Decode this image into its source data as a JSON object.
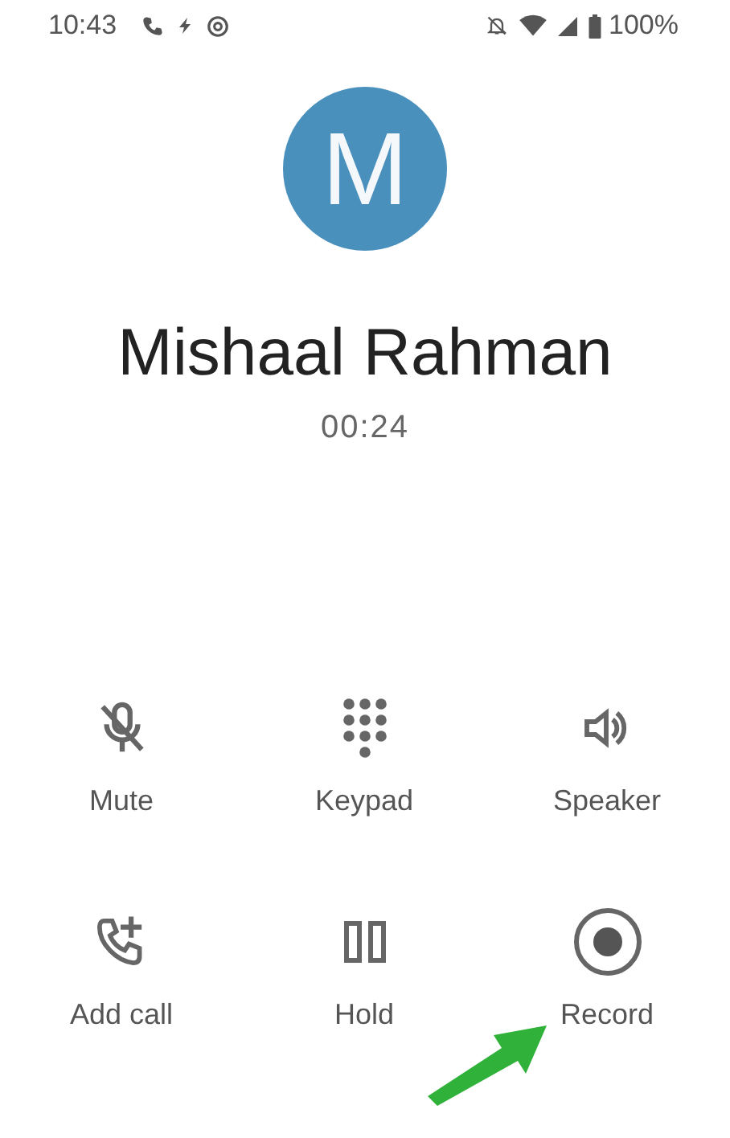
{
  "status_bar": {
    "time": "10:43",
    "battery": "100%"
  },
  "contact": {
    "initial": "M",
    "name": "Mishaal Rahman",
    "duration": "00:24"
  },
  "controls": [
    {
      "kind": "mute",
      "label": "Mute"
    },
    {
      "kind": "keypad",
      "label": "Keypad"
    },
    {
      "kind": "speaker",
      "label": "Speaker"
    },
    {
      "kind": "add_call",
      "label": "Add call"
    },
    {
      "kind": "hold",
      "label": "Hold"
    },
    {
      "kind": "record",
      "label": "Record"
    }
  ]
}
